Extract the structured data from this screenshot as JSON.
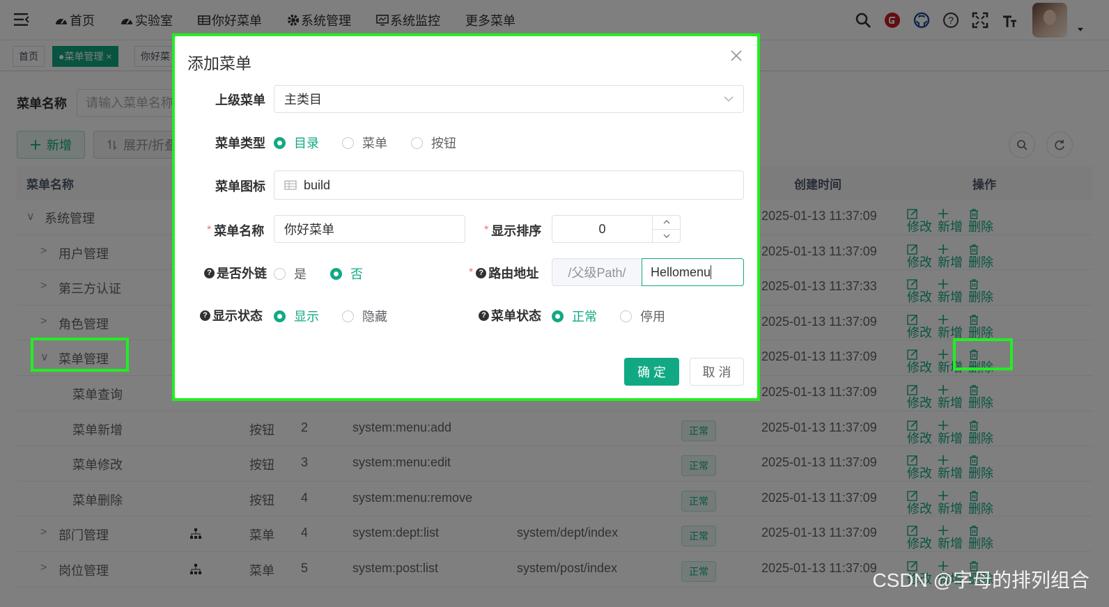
{
  "topnav": {
    "items": [
      "首页",
      "实验室",
      "你好菜单",
      "系统管理",
      "系统监控",
      "更多菜单"
    ]
  },
  "tags": {
    "home": "首页",
    "active": "●菜单管理",
    "active_close": "×",
    "third": "你好菜"
  },
  "search": {
    "label": "菜单名称",
    "placeholder": "请输入菜单名称"
  },
  "toolbar": {
    "add": "新增",
    "expand": "展开/折叠"
  },
  "table": {
    "headers": {
      "name": "菜单名称",
      "created": "创建时间",
      "ops": "操作"
    },
    "ops": {
      "edit": "修改",
      "add": "新增",
      "delete": "删除"
    },
    "rows": [
      {
        "chev": "∨",
        "name": "系统管理",
        "type": "",
        "order": "",
        "perm": "",
        "component": "",
        "status": "",
        "time": "2025-01-13 11:37:09"
      },
      {
        "chev": ">",
        "name": "用户管理",
        "type": "",
        "order": "",
        "perm": "",
        "component": "",
        "status": "",
        "time": "2025-01-13 11:37:09"
      },
      {
        "chev": ">",
        "name": "第三方认证",
        "type": "",
        "order": "",
        "perm": "",
        "component": "",
        "status": "",
        "time": "2025-01-13 11:37:33"
      },
      {
        "chev": ">",
        "name": "角色管理",
        "type": "",
        "order": "",
        "perm": "",
        "component": "",
        "status": "",
        "time": "2025-01-13 11:37:09"
      },
      {
        "chev": "∨",
        "name": "菜单管理",
        "type": "",
        "order": "",
        "perm": "",
        "component": "",
        "status": "",
        "time": "2025-01-13 11:37:09"
      },
      {
        "chev": "",
        "name": "菜单查询",
        "type": "",
        "order": "",
        "perm": "",
        "component": "",
        "status": "",
        "time": "2025-01-13 11:37:09"
      },
      {
        "chev": "",
        "name": "菜单新增",
        "type": "按钮",
        "order": "2",
        "perm": "system:menu:add",
        "component": "",
        "status": "正常",
        "time": "2025-01-13 11:37:09"
      },
      {
        "chev": "",
        "name": "菜单修改",
        "type": "按钮",
        "order": "3",
        "perm": "system:menu:edit",
        "component": "",
        "status": "正常",
        "time": "2025-01-13 11:37:09"
      },
      {
        "chev": "",
        "name": "菜单删除",
        "type": "按钮",
        "order": "4",
        "perm": "system:menu:remove",
        "component": "",
        "status": "正常",
        "time": "2025-01-13 11:37:09"
      },
      {
        "chev": ">",
        "name": "部门管理",
        "type": "菜单",
        "order": "4",
        "perm": "system:dept:list",
        "component": "system/dept/index",
        "status": "正常",
        "time": "2025-01-13 11:37:09"
      },
      {
        "chev": ">",
        "name": "岗位管理",
        "type": "菜单",
        "order": "5",
        "perm": "system:post:list",
        "component": "system/post/index",
        "status": "正常",
        "time": "2025-01-13 11:37:09"
      }
    ]
  },
  "dialog": {
    "title": "添加菜单",
    "close": "×",
    "parent_label": "上级菜单",
    "parent_value": "主类目",
    "type_label": "菜单类型",
    "type_options": [
      "目录",
      "菜单",
      "按钮"
    ],
    "type_selected": "目录",
    "icon_label": "菜单图标",
    "icon_value": "build",
    "name_label": "菜单名称",
    "name_value": "你好菜单",
    "order_label": "显示排序",
    "order_value": "0",
    "external_label": "是否外链",
    "external_options": [
      "是",
      "否"
    ],
    "external_selected": "否",
    "route_label": "路由地址",
    "route_prefix": "/父级Path/",
    "route_value": "Hellomenu",
    "visible_label": "显示状态",
    "visible_options": [
      "显示",
      "隐藏"
    ],
    "visible_selected": "显示",
    "status_label": "菜单状态",
    "status_options": [
      "正常",
      "停用"
    ],
    "status_selected": "正常",
    "confirm": "确 定",
    "cancel": "取 消",
    "required_mark": "*",
    "help_mark": "?"
  },
  "watermark": "CSDN @字母的排列组合",
  "colors": {
    "primary": "#11a983",
    "highlight": "#22ee22"
  }
}
